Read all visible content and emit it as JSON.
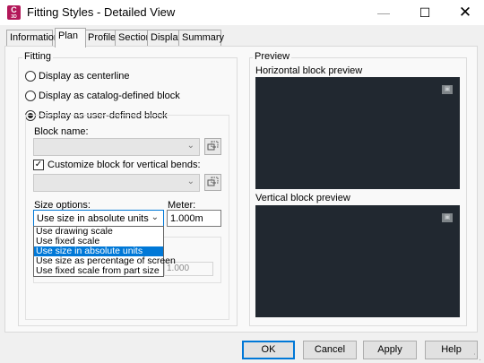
{
  "window": {
    "title": "Fitting Styles - Detailed View",
    "app_icon_letter": "C",
    "app_icon_sub": "3D"
  },
  "tabs": [
    {
      "label": "Information",
      "active": false
    },
    {
      "label": "Plan",
      "active": true
    },
    {
      "label": "Profile",
      "active": false
    },
    {
      "label": "Section",
      "active": false
    },
    {
      "label": "Display",
      "active": false
    },
    {
      "label": "Summary",
      "active": false
    }
  ],
  "fitting": {
    "group_label": "Fitting",
    "options": [
      {
        "label": "Display as centerline",
        "checked": false
      },
      {
        "label": "Display as catalog-defined block",
        "checked": false
      },
      {
        "label": "Display as user-defined block",
        "checked": true
      }
    ],
    "block_name_label": "Block name:",
    "block_name_value": "",
    "customize_label": "Customize block for vertical bends:",
    "customize_checked": true,
    "size_options_label": "Size options:",
    "size_options_value": "Use size in absolute units",
    "size_options_list": [
      "Use drawing scale",
      "Use fixed scale",
      "Use size in absolute units",
      "Use size as percentage of screen",
      "Use fixed scale from part size"
    ],
    "size_options_selected_index": 2,
    "meter_label": "Meter:",
    "meter_value": "1.000m",
    "hidden_value": "1.000"
  },
  "preview": {
    "group_label": "Preview",
    "horizontal_label": "Horizontal block preview",
    "vertical_label": "Vertical block preview",
    "background": "#212830"
  },
  "buttons": {
    "ok": "OK",
    "cancel": "Cancel",
    "apply": "Apply",
    "help": "Help"
  },
  "colors": {
    "accent": "#0078d7",
    "icon": "#b3185a"
  }
}
